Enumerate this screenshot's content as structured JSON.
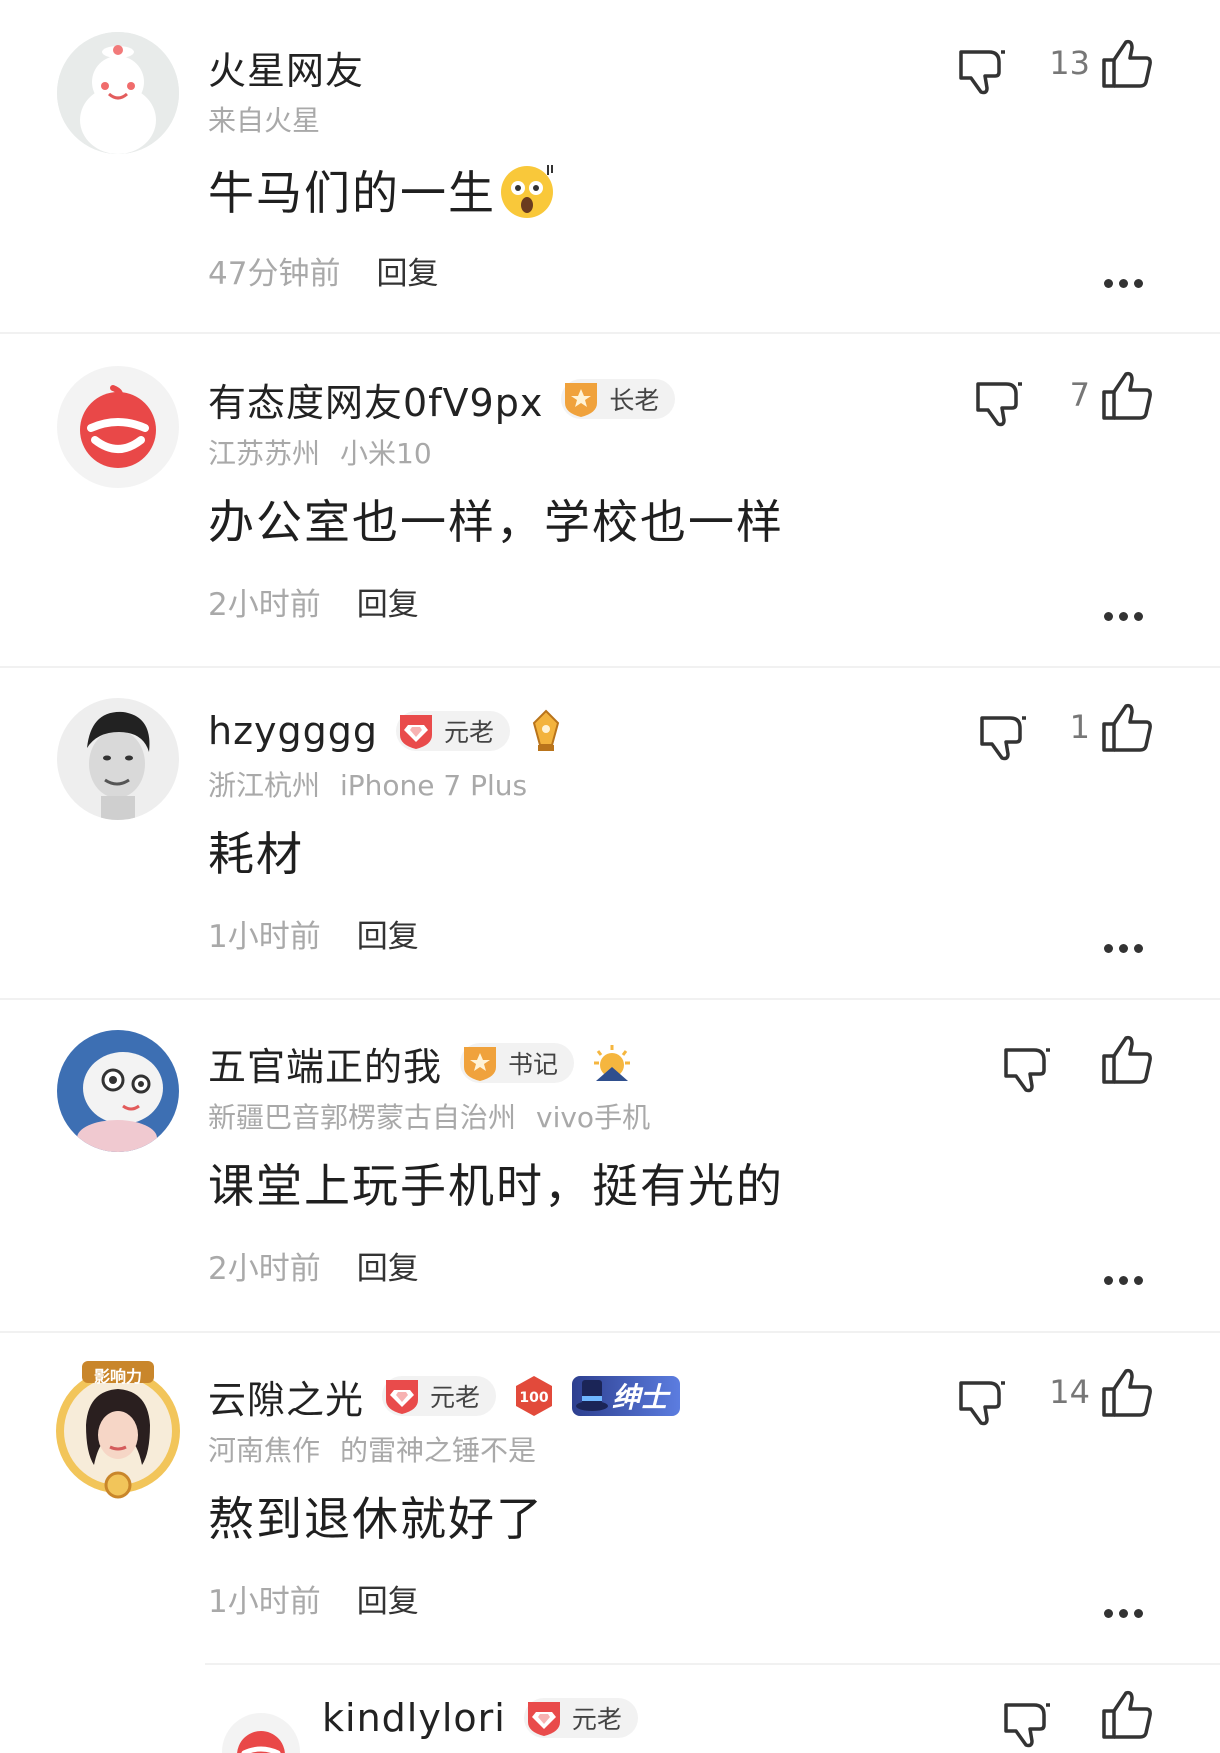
{
  "colors": {
    "background": "#ffffff",
    "text_primary": "#222222",
    "text_secondary": "#a9a9a9",
    "divider": "#f1f1f1",
    "badge_red": "#e94b4b",
    "badge_orange": "#f0a23c"
  },
  "comments": [
    {
      "username": "火星网友",
      "avatar_icon": "mars-user-avatar-icon",
      "badges": [],
      "location": "来自火星",
      "device": "",
      "content": "牛马们的一生",
      "emoji": "scream-emoji-icon",
      "time": "47分钟前",
      "reply_label": "回复",
      "likes": "13"
    },
    {
      "username": "有态度网友0fV9px",
      "avatar_icon": "netease-logo-avatar-icon",
      "badges": [
        {
          "label": "长老",
          "icon": "orange-star-shield-icon"
        }
      ],
      "location": "江苏苏州",
      "device": "小米10",
      "content": "办公室也一样，学校也一样",
      "time": "2小时前",
      "reply_label": "回复",
      "likes": "7"
    },
    {
      "username": "hzygggg",
      "avatar_icon": "man-photo-avatar-icon",
      "badges": [
        {
          "label": "元老",
          "icon": "red-gem-shield-icon"
        }
      ],
      "extra_icon": "gold-pen-icon",
      "location": "浙江杭州",
      "device": "iPhone 7 Plus",
      "content": "耗材",
      "time": "1小时前",
      "reply_label": "回复",
      "likes": "1"
    },
    {
      "username": "五官端正的我",
      "avatar_icon": "cartoon-mascot-avatar-icon",
      "badges": [
        {
          "label": "书记",
          "icon": "orange-star-shield-icon"
        }
      ],
      "extra_icon": "sunrise-icon",
      "location": "新疆巴音郭楞蒙古自治州",
      "device": "vivo手机",
      "content": "课堂上玩手机时，挺有光的",
      "time": "2小时前",
      "reply_label": "回复",
      "likes": ""
    },
    {
      "username": "云隙之光",
      "avatar_icon": "woman-illustration-avatar-icon",
      "avatar_ribbon": "影响力",
      "badges": [
        {
          "label": "元老",
          "icon": "red-gem-shield-icon"
        }
      ],
      "extra_icon": "hundred-hexagon-icon",
      "title_badge": "绅士",
      "location": "河南焦作",
      "device": "的雷神之锤不是",
      "content": "熬到退休就好了",
      "time": "1小时前",
      "reply_label": "回复",
      "likes": "14"
    }
  ],
  "partial_comment": {
    "username": "kindlylori",
    "badge_label": "元老"
  }
}
